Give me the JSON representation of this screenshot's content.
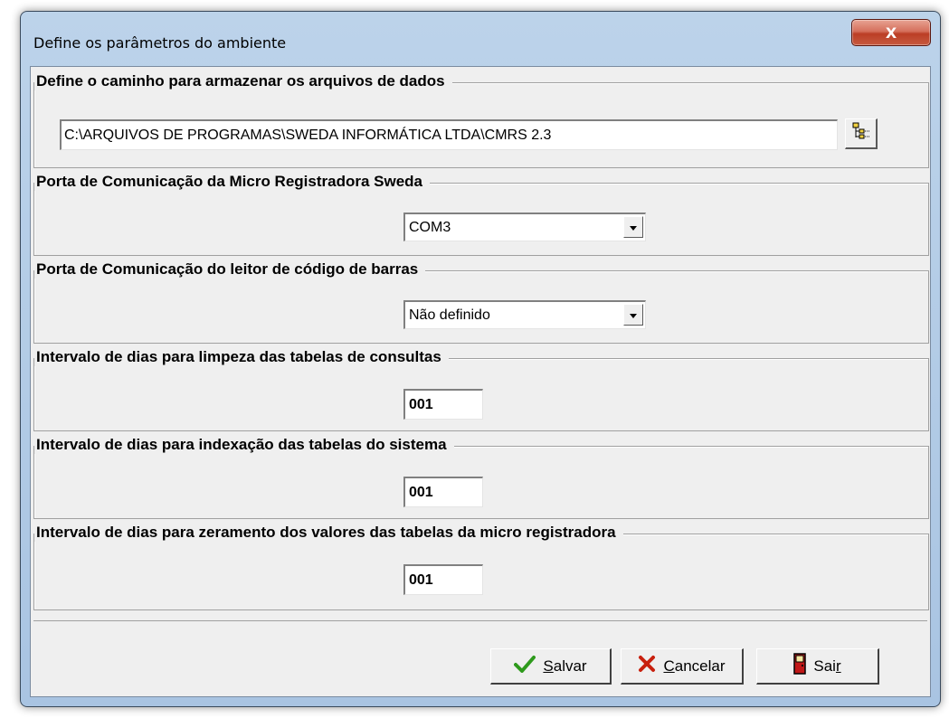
{
  "window": {
    "title": "Define os parâmetros do ambiente",
    "close_glyph": "X"
  },
  "groups": {
    "path": {
      "legend": "Define o caminho para armazenar os arquivos de dados",
      "value": "C:\\ARQUIVOS DE PROGRAMAS\\SWEDA INFORMÁTICA LTDA\\CMRS 2.3",
      "browse_icon": "folder-tree-icon"
    },
    "printer_port": {
      "legend": "Porta de Comunicação da Micro Registradora Sweda",
      "selected": "COM3"
    },
    "scanner_port": {
      "legend": "Porta de Comunicação do leitor de código de barras",
      "selected": "Não definido"
    },
    "cleanup_interval": {
      "legend": "Intervalo de dias para limpeza das tabelas de consultas",
      "value": "001"
    },
    "index_interval": {
      "legend": "Intervalo de dias para indexação das tabelas do sistema",
      "value": "001"
    },
    "reset_interval": {
      "legend": "Intervalo de dias para zeramento dos valores das tabelas da micro registradora",
      "value": "001"
    }
  },
  "buttons": {
    "save": {
      "label": "Salvar",
      "icon": "checkmark-icon",
      "color": "#2e9a1c"
    },
    "cancel": {
      "label": "Cancelar",
      "icon": "x-icon",
      "color": "#c8200e"
    },
    "exit_prefix": "Sai",
    "exit_suffix": "r",
    "exit_icon": "door-icon"
  }
}
